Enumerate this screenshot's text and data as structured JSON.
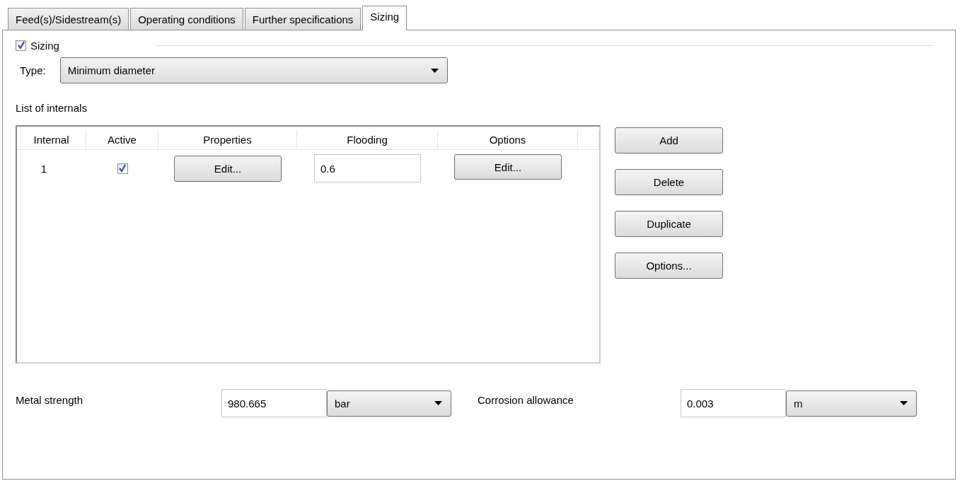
{
  "tabs": [
    {
      "label": "Feed(s)/Sidestream(s)",
      "selected": false
    },
    {
      "label": "Operating conditions",
      "selected": false
    },
    {
      "label": "Further specifications",
      "selected": false
    },
    {
      "label": "Sizing",
      "selected": true
    }
  ],
  "sizing": {
    "label": "Sizing",
    "checked": true,
    "type_label": "Type:",
    "type_value": "Minimum diameter"
  },
  "internals": {
    "title": "List of internals",
    "columns": [
      "Internal",
      "Active",
      "Properties",
      "Flooding",
      "Options"
    ],
    "rows": [
      {
        "internal": "1",
        "active": true,
        "properties": "Edit...",
        "flooding": "0.6",
        "options": "Edit..."
      }
    ]
  },
  "buttons": [
    "Add",
    "Delete",
    "Duplicate",
    "Options..."
  ],
  "metal_strength": {
    "label": "Metal strength",
    "value": "980.665",
    "unit": "bar"
  },
  "corrosion_allowance": {
    "label": "Corrosion allowance",
    "value": "0.003",
    "unit": "m"
  }
}
